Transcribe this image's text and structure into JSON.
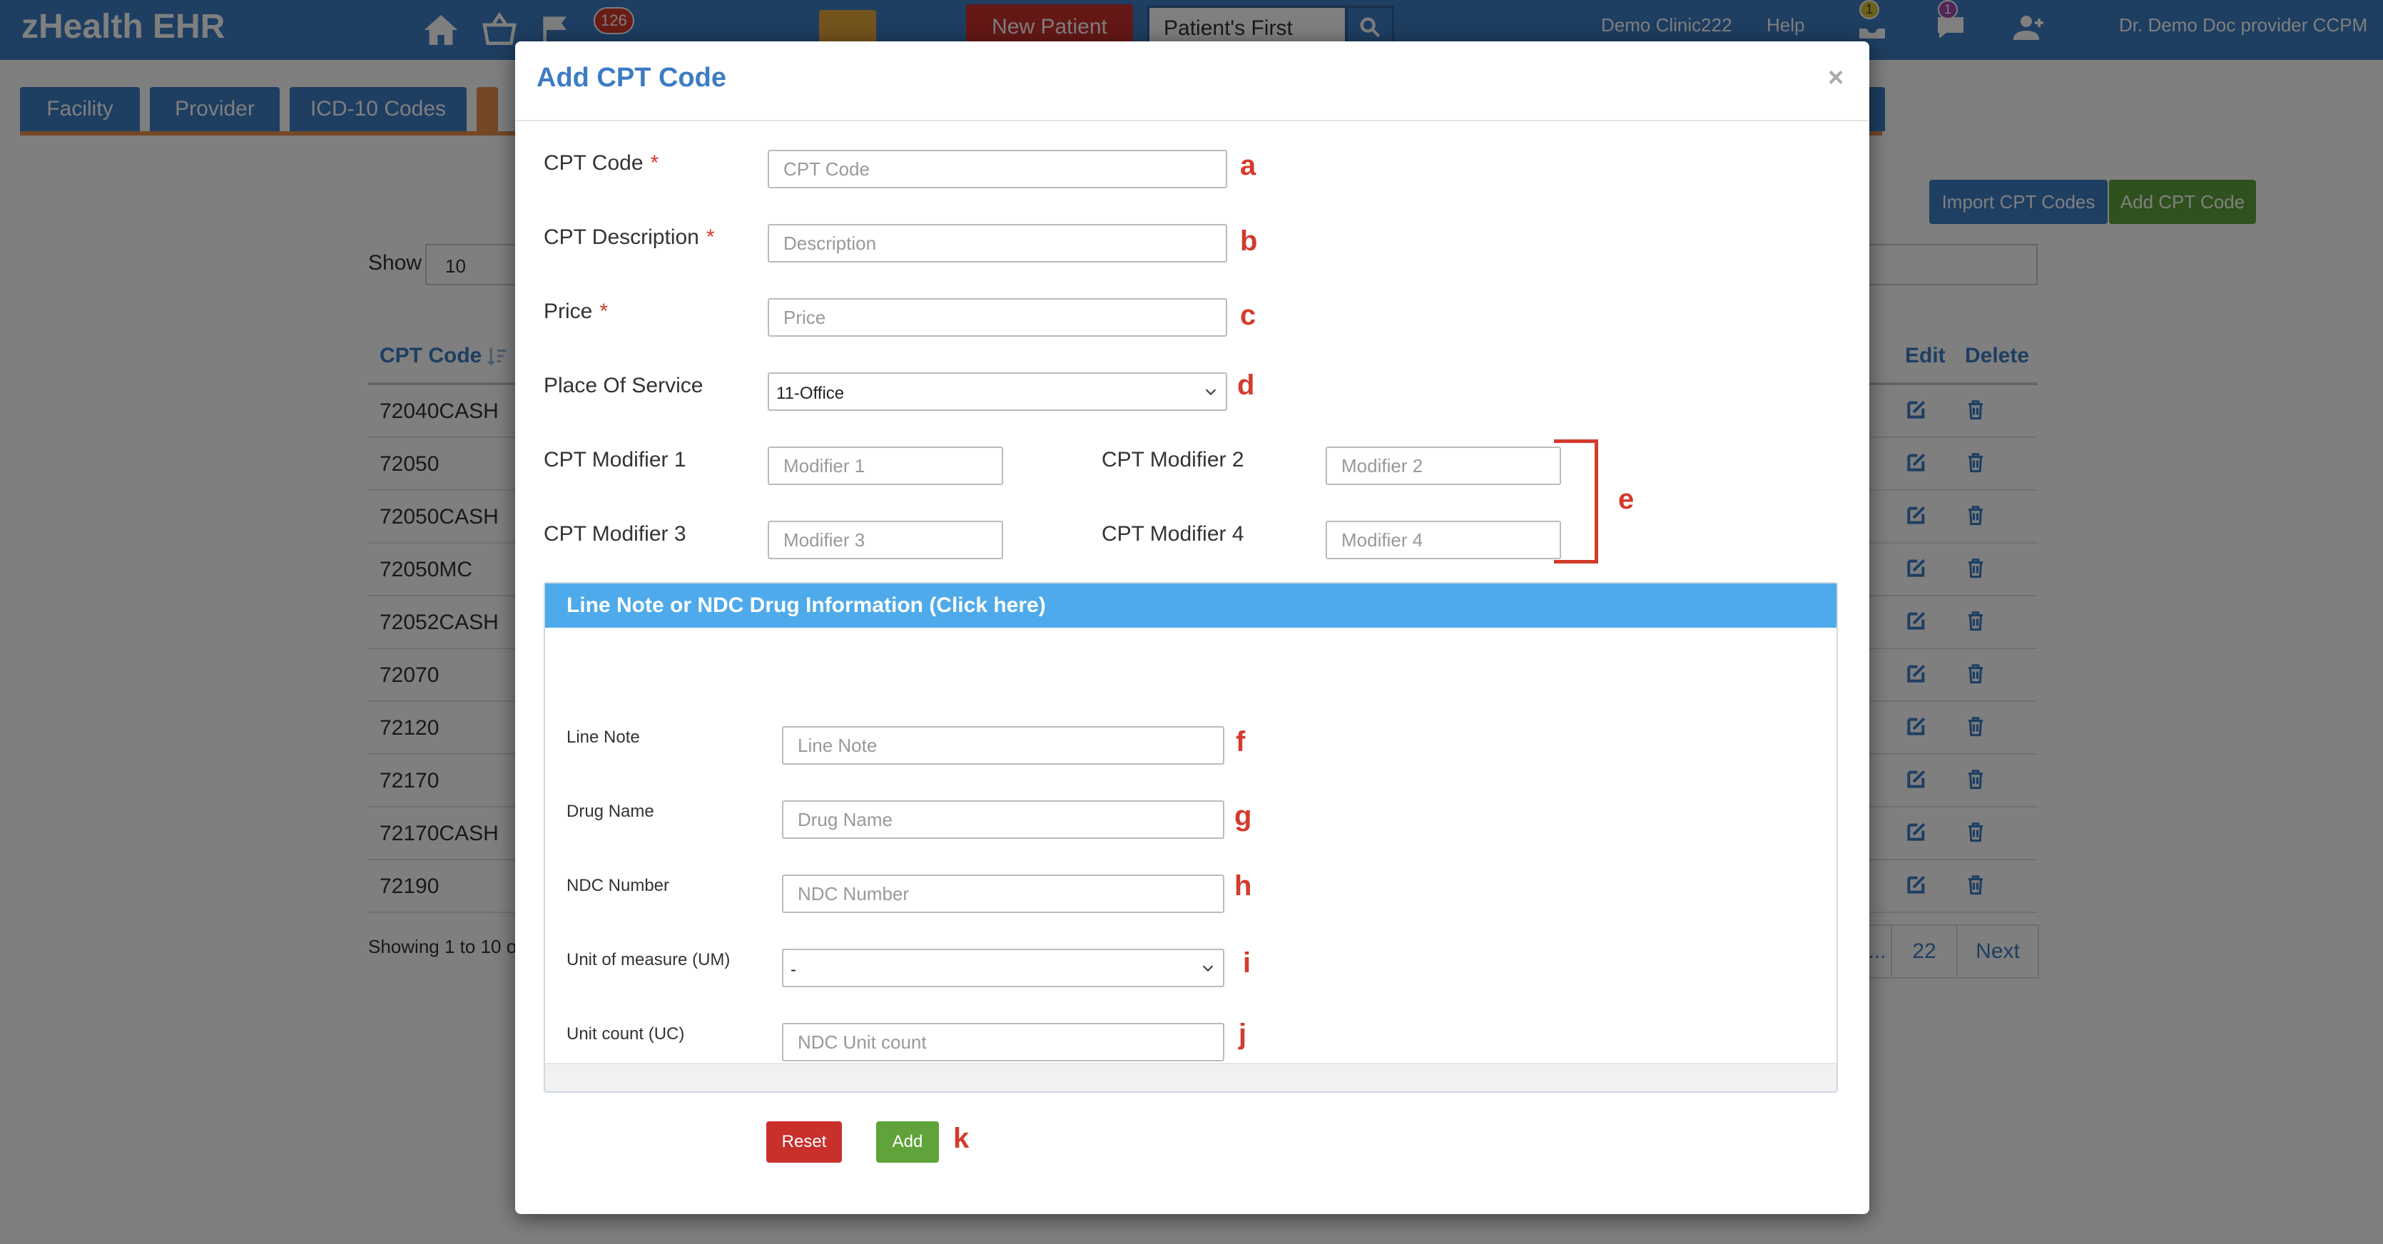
{
  "app": {
    "brand": "zHealth EHR",
    "notification_count": "126",
    "new_patient_label": "New Patient",
    "patient_search_mode": "Patient's First",
    "clinic_name": "Demo Clinic222",
    "help_label": "Help",
    "messages_badge": "1",
    "chat_badge": "1",
    "user_name": "Dr. Demo Doc provider CCPM"
  },
  "tabs": [
    {
      "label": "Facility"
    },
    {
      "label": "Provider"
    },
    {
      "label": "ICD-10 Codes"
    }
  ],
  "toolbar": {
    "import_label": "Import CPT Codes",
    "add_label": "Add CPT Code"
  },
  "list": {
    "show_label": "Show",
    "show_value": "10",
    "columns": {
      "code": "CPT Code",
      "edit": "Edit",
      "delete": "Delete"
    },
    "rows": [
      {
        "code": "72040CASH"
      },
      {
        "code": "72050"
      },
      {
        "code": "72050CASH"
      },
      {
        "code": "72050MC"
      },
      {
        "code": "72052CASH"
      },
      {
        "code": "72070"
      },
      {
        "code": "72120"
      },
      {
        "code": "72170"
      },
      {
        "code": "72170CASH"
      },
      {
        "code": "72190"
      }
    ],
    "showing_text": "Showing 1 to 10 of",
    "pager": {
      "ellipsis": "...",
      "last_page": "22",
      "next_label": "Next"
    }
  },
  "modal": {
    "title": "Add CPT Code",
    "close_symbol": "×",
    "fields": {
      "cpt_code": {
        "label": "CPT Code",
        "required": "*",
        "placeholder": "CPT Code",
        "marker": "a"
      },
      "description": {
        "label": "CPT Description",
        "required": "*",
        "placeholder": "Description",
        "marker": "b"
      },
      "price": {
        "label": "Price",
        "required": "*",
        "placeholder": "Price",
        "marker": "c"
      },
      "place_of_service": {
        "label": "Place Of Service",
        "value": "11-Office",
        "marker": "d"
      },
      "modifier1": {
        "label": "CPT Modifier 1",
        "placeholder": "Modifier 1"
      },
      "modifier2": {
        "label": "CPT Modifier 2",
        "placeholder": "Modifier 2"
      },
      "modifier3": {
        "label": "CPT Modifier 3",
        "placeholder": "Modifier 3"
      },
      "modifier4": {
        "label": "CPT Modifier 4",
        "placeholder": "Modifier 4"
      },
      "modifiers_marker": "e"
    },
    "panel": {
      "title": "Line Note or NDC Drug Information (Click here)",
      "line_note": {
        "label": "Line Note",
        "placeholder": "Line Note",
        "marker": "f"
      },
      "drug_name": {
        "label": "Drug Name",
        "placeholder": "Drug Name",
        "marker": "g"
      },
      "ndc_number": {
        "label": "NDC Number",
        "placeholder": "NDC Number",
        "marker": "h"
      },
      "unit_measure": {
        "label": "Unit of measure (UM)",
        "value": "-",
        "marker": "i"
      },
      "unit_count": {
        "label": "Unit count (UC)",
        "placeholder": "NDC Unit count",
        "marker": "j"
      }
    },
    "buttons": {
      "reset_label": "Reset",
      "add_label": "Add",
      "marker": "k"
    }
  },
  "colors": {
    "brand_blue": "#3d7cc4",
    "panel_blue": "#4eaaea",
    "danger_red": "#c9302c",
    "success_green": "#5fa33a",
    "annotation_red": "#d33b2c"
  }
}
